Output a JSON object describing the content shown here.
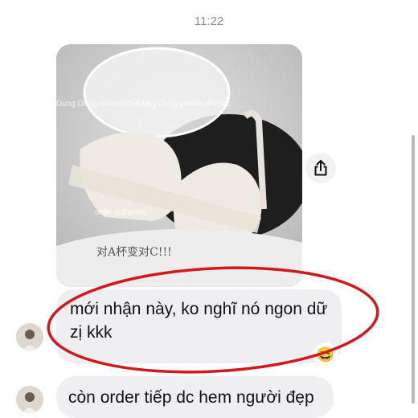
{
  "status": {
    "time": "11:22"
  },
  "photo": {
    "watermark_1": "Dung Dung orderauthentic",
    "watermark_2": "Dung Dung orderauthentic",
    "watermark_3": "orderauthentic",
    "box_text": "对A杯变对C!!!"
  },
  "messages": [
    {
      "text_line1": "mới nhận này, ko nghĩ nó ngon dữ",
      "text_line2": "zị kkk",
      "reaction": "😆"
    },
    {
      "text": "còn order tiếp dc hem người đẹp"
    }
  ],
  "colors": {
    "bubble": "#efeff2",
    "annotation": "#d1181e",
    "timestamp": "#8e8e93"
  },
  "icons": {
    "share": "share-icon"
  }
}
